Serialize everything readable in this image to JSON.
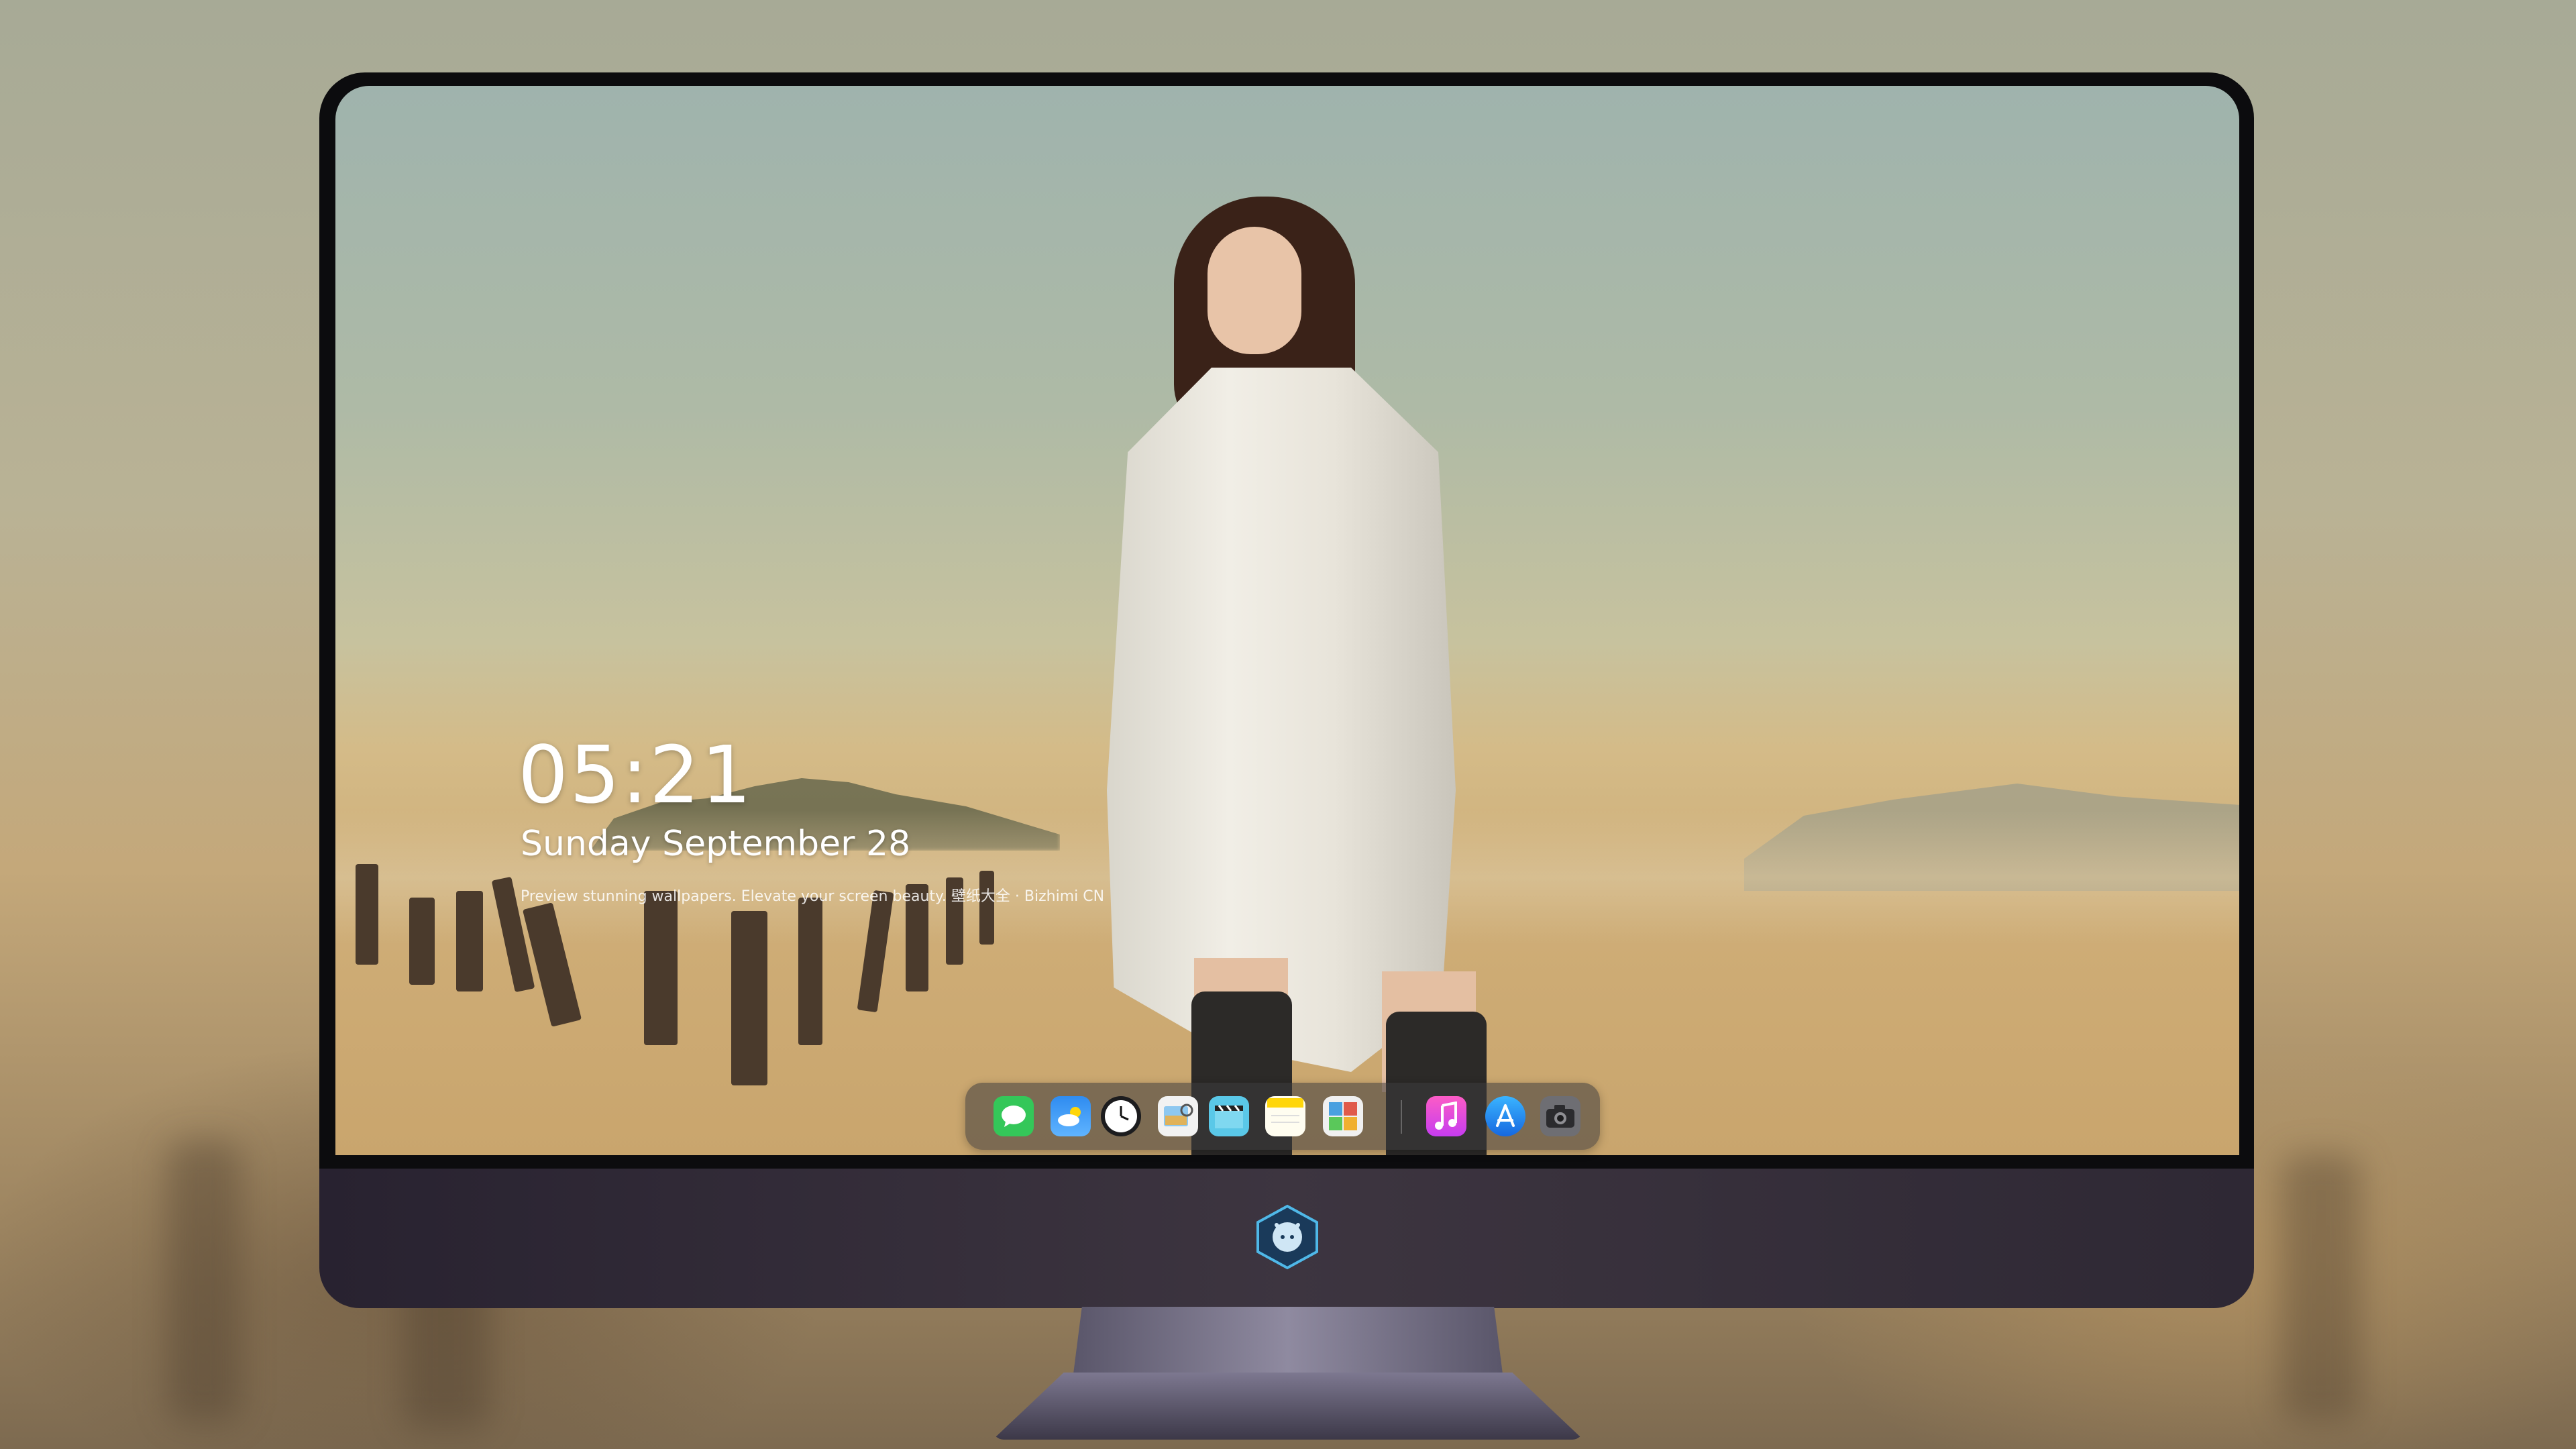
{
  "lockscreen": {
    "time": "05:21",
    "date": "Sunday September  28",
    "tagline": "Preview stunning wallpapers. Elevate your screen beauty. 壁纸大全 · Bizhimi CN"
  },
  "dock": {
    "apps": [
      {
        "icon": "messages-icon",
        "color": "#34c759"
      },
      {
        "icon": "weather-icon",
        "color": "#2f8cf0"
      },
      {
        "icon": "clock-icon",
        "color": "#1c1c1e"
      },
      {
        "icon": "preview-icon",
        "color": "#f2f2f2"
      },
      {
        "icon": "clips-icon",
        "color": "#5ac8e8"
      },
      {
        "icon": "notes-icon",
        "color": "#ffd60a"
      },
      {
        "icon": "photo-booth-icon",
        "color": "#f0f0f0"
      },
      {
        "icon": "music-icon",
        "color": "#fc3cbe"
      },
      {
        "icon": "app-store-icon",
        "color": "#1e90ff"
      },
      {
        "icon": "camera-icon",
        "color": "#6e6e73"
      }
    ]
  }
}
